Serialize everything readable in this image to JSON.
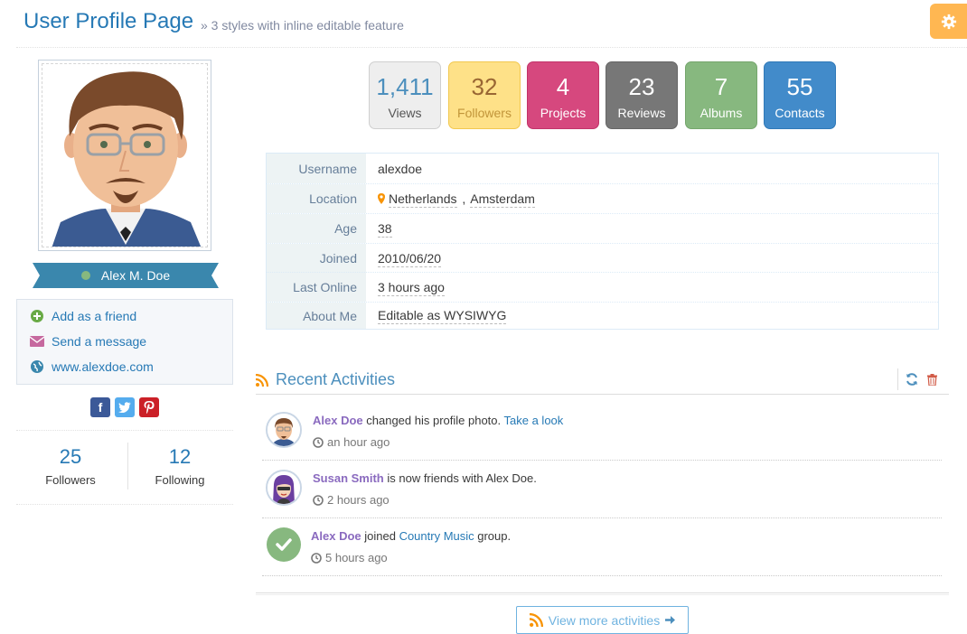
{
  "header": {
    "title": "User Profile Page",
    "subtitle": "» 3 styles with inline editable feature",
    "settings_icon": "gear-icon",
    "settings_color": "#ffb752"
  },
  "profile": {
    "name": "Alex M. Doe",
    "status": "online",
    "links": [
      {
        "label": "Add as a friend",
        "icon": "plus-circle-icon"
      },
      {
        "label": "Send a message",
        "icon": "envelope-icon"
      },
      {
        "label": "www.alexdoe.com",
        "icon": "globe-icon"
      }
    ],
    "social": [
      "facebook-icon",
      "twitter-icon",
      "pinterest-icon"
    ],
    "followers": {
      "count": "25",
      "label": "Followers"
    },
    "following": {
      "count": "12",
      "label": "Following"
    }
  },
  "stats": [
    {
      "value": "1,411",
      "label": "Views",
      "color": "#e6e6e6"
    },
    {
      "value": "32",
      "label": "Followers",
      "color": "#fee188"
    },
    {
      "value": "4",
      "label": "Projects",
      "color": "#d6487e"
    },
    {
      "value": "23",
      "label": "Reviews",
      "color": "#777777"
    },
    {
      "value": "7",
      "label": "Albums",
      "color": "#87b87f"
    },
    {
      "value": "55",
      "label": "Contacts",
      "color": "#428bca"
    }
  ],
  "info": {
    "username_label": "Username",
    "username": "alexdoe",
    "location_label": "Location",
    "country": "Netherlands",
    "city": "Amsterdam",
    "age_label": "Age",
    "age": "38",
    "joined_label": "Joined",
    "joined": "2010/06/20",
    "last_online_label": "Last Online",
    "last_online": "3 hours ago",
    "about_label": "About Me",
    "about": "Editable as WYSIWYG"
  },
  "activities": {
    "title": "Recent Activities",
    "items": [
      {
        "user": "Alex Doe",
        "text": " changed his profile photo. ",
        "link": "Take a look",
        "after": "",
        "time": "an hour ago"
      },
      {
        "user": "Susan Smith",
        "text": " is now friends with Alex Doe.",
        "link": "",
        "after": "",
        "time": "2 hours ago"
      },
      {
        "user": "Alex Doe",
        "text": " joined ",
        "link": "Country Music",
        "after": " group.",
        "time": "5 hours ago"
      }
    ],
    "view_more": "View more activities"
  }
}
